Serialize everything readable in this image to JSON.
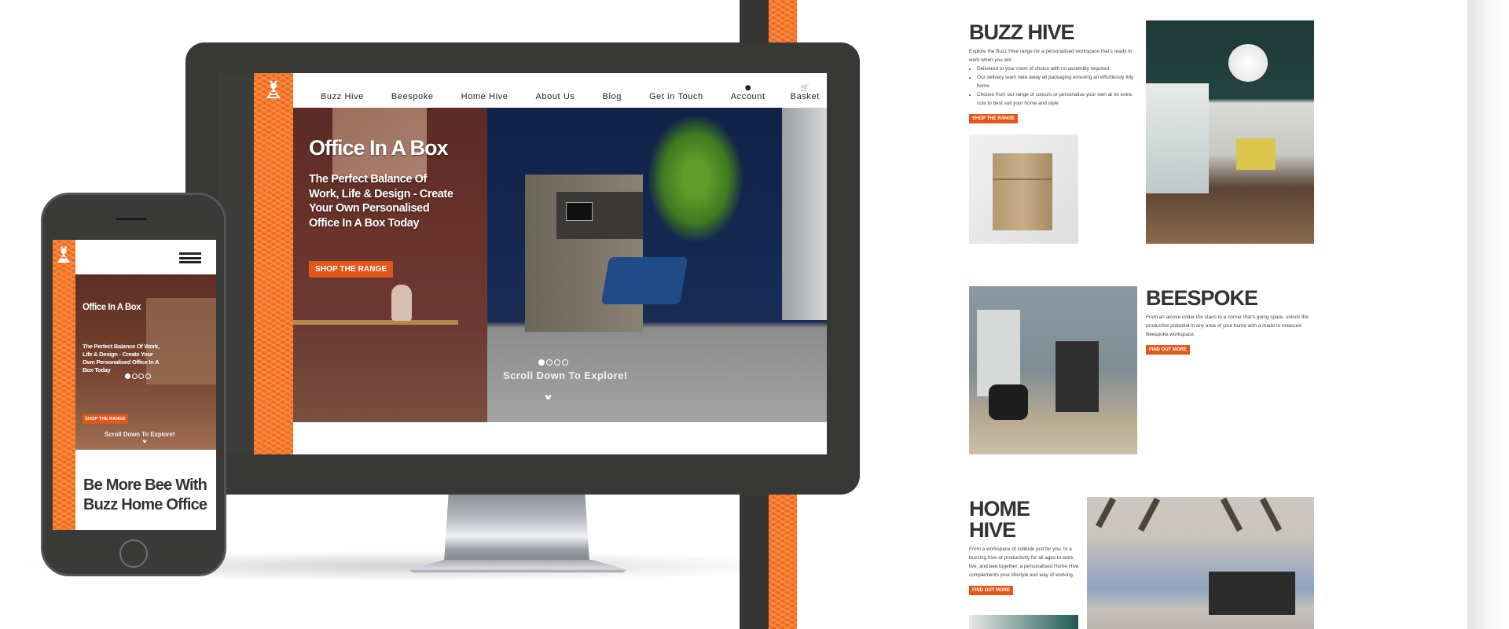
{
  "brand": {
    "name": "Buzz Home Office",
    "accent": "#e2571b",
    "pattern_color": "#ef6a1f",
    "device_color": "#383836"
  },
  "desktop": {
    "nav": {
      "items": [
        "Buzz Hive",
        "Beespoke",
        "Home Hive",
        "About Us",
        "Blog",
        "Get in Touch"
      ],
      "account_label": "Account",
      "basket_label": "Basket",
      "account_icon": "user-icon",
      "basket_icon": "cart-icon"
    },
    "hero": {
      "title": "Office In A Box",
      "subtitle_lines": [
        "The Perfect Balance Of",
        "Work, Life & Design - Create",
        "Your Own Personalised",
        "Office In A Box Today"
      ],
      "cta": "SHOP THE RANGE",
      "slides": 4,
      "active_slide": 1,
      "scroll_text": "Scroll Down To Explore!",
      "scroll_icon": "chevron-down-icon"
    }
  },
  "mobile": {
    "menu_icon": "hamburger-icon",
    "hero": {
      "title": "Office In A Box",
      "subtitle_lines": [
        "The Perfect Balance Of Work,",
        "Life & Design - Create Your",
        "Own Personalised Office In A",
        "Box Today"
      ],
      "cta": "SHOP THE RANGE",
      "slides": 4,
      "active_slide": 1,
      "scroll_text": "Scroll Down To Explore!"
    },
    "tagline_lines": [
      "Be More Bee With",
      "Buzz Home Office"
    ]
  },
  "page": {
    "sections": [
      {
        "title": "BUZZ HIVE",
        "intro": "Explore the Buzz Hive range for a personalised workspace that's ready to work when you are:",
        "bullets": [
          "Delivered to your room of choice with no assembly required",
          "Our delivery team take away all packaging ensuring an effortlessly tidy home",
          "Choose from our range of colours or personalise your own at no extra cost to best suit your home and style"
        ],
        "cta": "SHOP THE RANGE"
      },
      {
        "title": "BEESPOKE",
        "body": "From an alcove under the stairs to a corner that's going spare, unlock the productive potential in any area of your home with a made to measure Beespoke workspace.",
        "cta": "FIND OUT MORE"
      },
      {
        "title": "HOME HIVE",
        "body": "From a workspace of solitude just for you, to a buzzing hive or productivity for all ages to work, live, and bee together, a personalised Home Hive complements your lifestyle and way of working.",
        "cta": "FIND OUT MORE"
      }
    ]
  }
}
